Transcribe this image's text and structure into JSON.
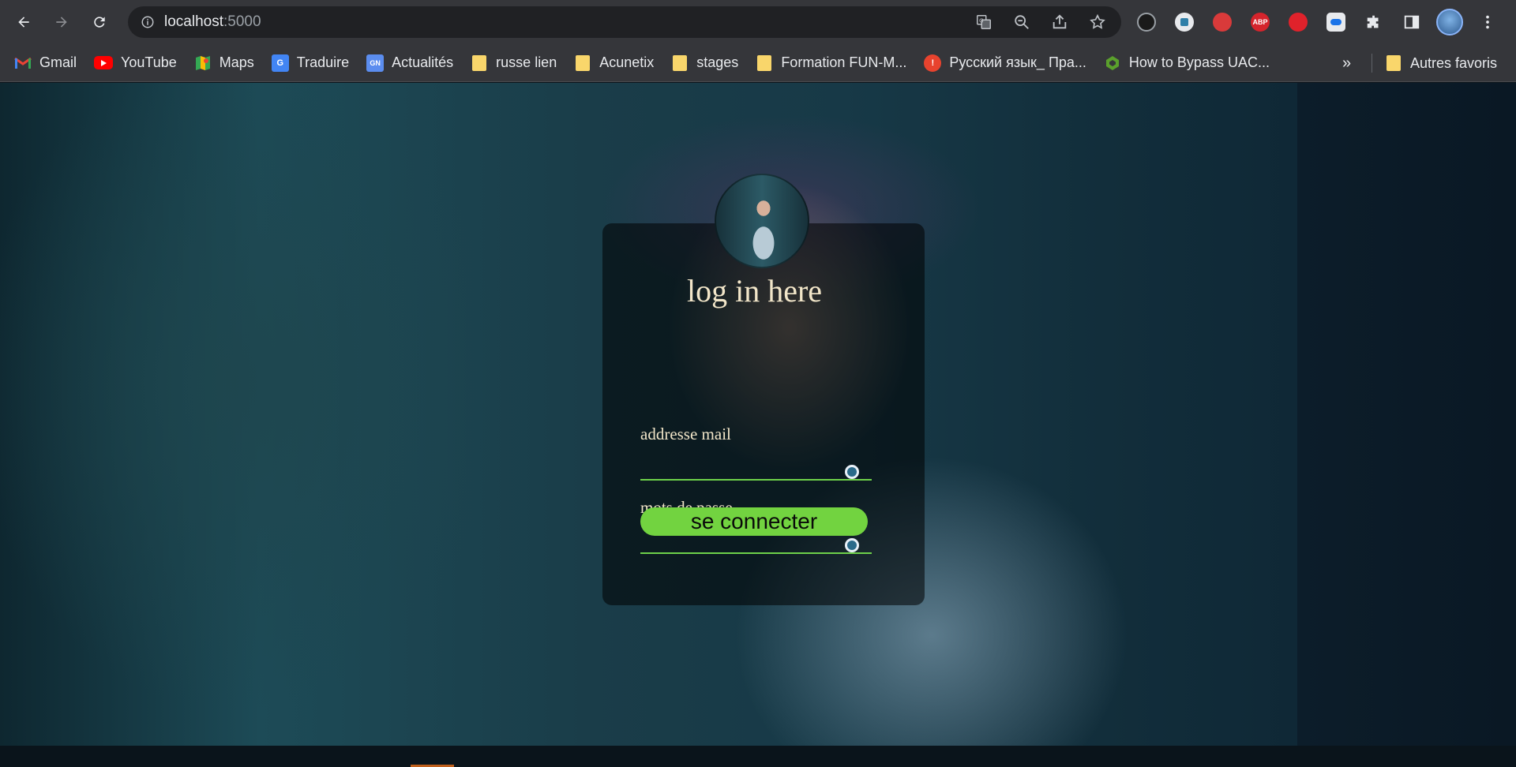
{
  "browser": {
    "url_host": "localhost",
    "url_port": ":5000",
    "bookmarks": [
      {
        "label": "Gmail",
        "icon": "gmail-icon"
      },
      {
        "label": "YouTube",
        "icon": "youtube-icon"
      },
      {
        "label": "Maps",
        "icon": "maps-icon"
      },
      {
        "label": "Traduire",
        "icon": "translate-icon"
      },
      {
        "label": "Actualités",
        "icon": "news-icon"
      },
      {
        "label": "russe lien",
        "icon": "folder-icon"
      },
      {
        "label": "Acunetix",
        "icon": "folder-icon"
      },
      {
        "label": "stages",
        "icon": "folder-icon"
      },
      {
        "label": "Formation FUN-M...",
        "icon": "folder-icon"
      },
      {
        "label": "Русский язык_ Пра...",
        "icon": "warning-icon"
      },
      {
        "label": "How to Bypass UAC...",
        "icon": "site-icon"
      }
    ],
    "more_bookmarks": "»",
    "other_bookmarks": "Autres favoris",
    "colors": {
      "chrome": "#35363a",
      "omnibox": "#202124"
    }
  },
  "login": {
    "title": "log in here",
    "email_label": "addresse mail",
    "email_value": "",
    "password_label": "mots de passe",
    "password_value": "",
    "submit_label": "se connecter",
    "colors": {
      "accent": "#72d340",
      "text": "#f2e6c9",
      "card": "rgba(0,0,0,0.55)"
    }
  }
}
